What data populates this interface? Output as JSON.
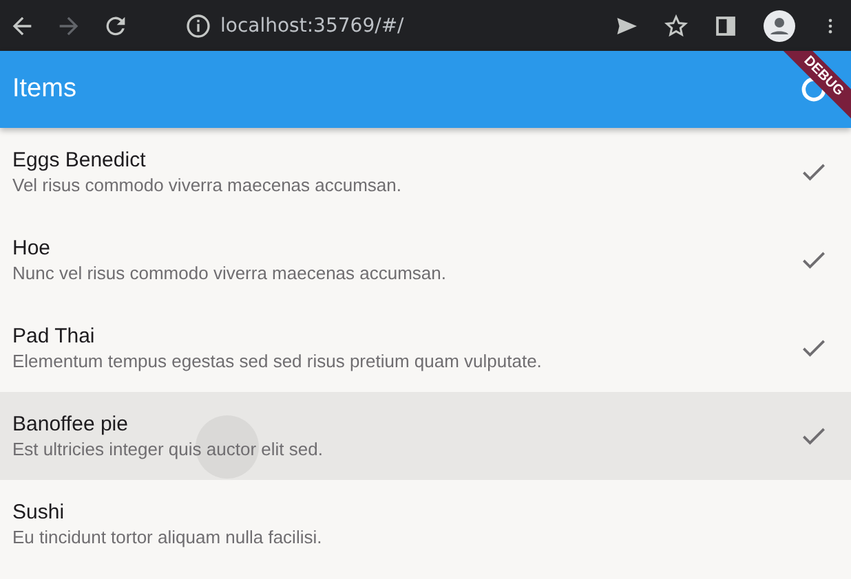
{
  "browser": {
    "url": "localhost:35769/#/",
    "forward_disabled": true
  },
  "app_bar": {
    "title": "Items",
    "debug_banner": "DEBUG"
  },
  "items": [
    {
      "title": "Eggs Benedict",
      "subtitle": "Vel risus commodo viverra maecenas accumsan.",
      "checked": true,
      "hovered": false
    },
    {
      "title": "Hoe",
      "subtitle": "Nunc vel risus commodo viverra maecenas accumsan.",
      "checked": true,
      "hovered": false
    },
    {
      "title": "Pad Thai",
      "subtitle": "Elementum tempus egestas sed sed risus pretium quam vulputate.",
      "checked": true,
      "hovered": false
    },
    {
      "title": "Banoffee pie",
      "subtitle": "Est ultricies integer quis auctor elit sed.",
      "checked": true,
      "hovered": true
    },
    {
      "title": "Sushi",
      "subtitle": "Eu tincidunt tortor aliquam nulla facilisi.",
      "checked": false,
      "hovered": false
    }
  ]
}
